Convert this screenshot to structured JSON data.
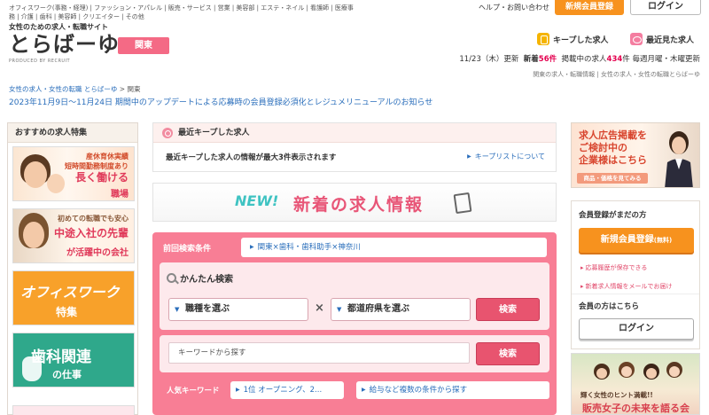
{
  "header": {
    "categories": "オフィスワーク(事務・経理) | ファッション・アパレル | 販売・サービス | 営業 | 美容部 | エステ・ネイル | 看護師 | 医療事務 | 介護 | 歯科 | 美容師 | クリエイター | その他",
    "tagline": "女性のための求人・転職サイト",
    "logo": "とらばーゆ",
    "logo_sub": "PRODUCED BY RECRUIT",
    "region": "関東",
    "help": "ヘルプ・お問い合わせ",
    "register": "新規会員登録",
    "login": "ログイン",
    "kept_jobs": "キープした求人",
    "recent_jobs": "最近見た求人",
    "update": {
      "date": "11/23（木）更新",
      "new_label": "新着",
      "new_count": "56件",
      "listed_label": "掲載中の求人",
      "listed_count": "434",
      "listed_suffix": "件 毎週月曜・木曜更新"
    },
    "meta": "関東の求人・転職情報 | 女性の求人・女性の転職とらばーゆ"
  },
  "breadcrumb": {
    "home": "女性の求人・女性の転職 とらばーゆ",
    "sep": ">",
    "current": "関東"
  },
  "notice": "2023年11月9日〜11月24日 期間中のアップデートによる応募時の会員登録必須化とレジュメリニューアルのお知らせ",
  "left": {
    "title": "おすすめの求人特集",
    "banners": [
      {
        "line1": "産休育休実績\n短時間勤務制度あり",
        "line2": "長く働ける",
        "line3": "職場"
      },
      {
        "line1": "初めての転職でも安心",
        "line2": "中途入社の先輩",
        "line3": "が活躍中の会社"
      },
      {
        "main": "オフィスワーク",
        "sub": "特集"
      },
      {
        "main": "歯科関連",
        "sub": "の仕事"
      }
    ]
  },
  "center": {
    "kept_title": "最近キープした求人",
    "kept_text": "最近キープした求人の情報が最大3件表示されます",
    "kept_link": "キープリストについて",
    "new_tag": "NEW!",
    "new_title": "新着の求人情報",
    "search": {
      "prev_label": "前回検索条件",
      "prev_value": "関東×歯科・歯科助手×神奈川",
      "easy_title": "かんたん検索",
      "job_select": "職種を選ぶ",
      "times": "×",
      "pref_select": "都道府県を選ぶ",
      "search_btn": "検索",
      "keyword_placeholder": "キーワードから探す",
      "search_btn2": "検索",
      "popular_label": "人気キーワード",
      "popular_1": "1位 オープニング、2...",
      "multi_link": "給与など複数の条件から探す"
    }
  },
  "right": {
    "ad_text": "求人広告掲載を\nご検討中の\n企業様はこちら",
    "ad_btn": "商品・価格を見てみる",
    "member_title": "会員登録がまだの方",
    "register_btn": "新規会員登録",
    "register_free": "(無料)",
    "merit1": "応募履歴が保存できる",
    "merit2": "新着求人情報をメールでお届け",
    "member_title2": "会員の方はこちら",
    "login_btn": "ログイン",
    "ad2_small": "輝く女性のヒント満載!!",
    "ad2_main": "販売女子の未来を語る会"
  },
  "colors": {
    "brand_pink": "#f46a85",
    "orange": "#f7921e",
    "link": "#2a6ebb"
  }
}
